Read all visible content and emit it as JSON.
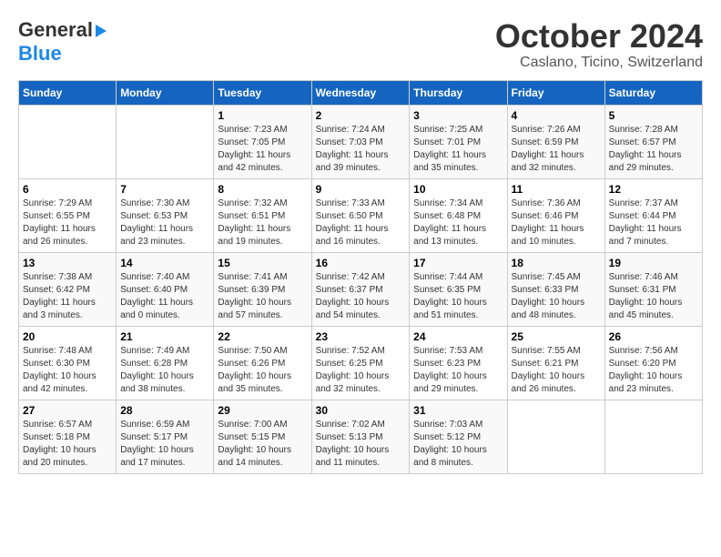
{
  "logo": {
    "line1": "General",
    "line2": "Blue"
  },
  "title": "October 2024",
  "subtitle": "Caslano, Ticino, Switzerland",
  "weekdays": [
    "Sunday",
    "Monday",
    "Tuesday",
    "Wednesday",
    "Thursday",
    "Friday",
    "Saturday"
  ],
  "weeks": [
    [
      {
        "day": "",
        "info": ""
      },
      {
        "day": "",
        "info": ""
      },
      {
        "day": "1",
        "info": "Sunrise: 7:23 AM\nSunset: 7:05 PM\nDaylight: 11 hours and 42 minutes."
      },
      {
        "day": "2",
        "info": "Sunrise: 7:24 AM\nSunset: 7:03 PM\nDaylight: 11 hours and 39 minutes."
      },
      {
        "day": "3",
        "info": "Sunrise: 7:25 AM\nSunset: 7:01 PM\nDaylight: 11 hours and 35 minutes."
      },
      {
        "day": "4",
        "info": "Sunrise: 7:26 AM\nSunset: 6:59 PM\nDaylight: 11 hours and 32 minutes."
      },
      {
        "day": "5",
        "info": "Sunrise: 7:28 AM\nSunset: 6:57 PM\nDaylight: 11 hours and 29 minutes."
      }
    ],
    [
      {
        "day": "6",
        "info": "Sunrise: 7:29 AM\nSunset: 6:55 PM\nDaylight: 11 hours and 26 minutes."
      },
      {
        "day": "7",
        "info": "Sunrise: 7:30 AM\nSunset: 6:53 PM\nDaylight: 11 hours and 23 minutes."
      },
      {
        "day": "8",
        "info": "Sunrise: 7:32 AM\nSunset: 6:51 PM\nDaylight: 11 hours and 19 minutes."
      },
      {
        "day": "9",
        "info": "Sunrise: 7:33 AM\nSunset: 6:50 PM\nDaylight: 11 hours and 16 minutes."
      },
      {
        "day": "10",
        "info": "Sunrise: 7:34 AM\nSunset: 6:48 PM\nDaylight: 11 hours and 13 minutes."
      },
      {
        "day": "11",
        "info": "Sunrise: 7:36 AM\nSunset: 6:46 PM\nDaylight: 11 hours and 10 minutes."
      },
      {
        "day": "12",
        "info": "Sunrise: 7:37 AM\nSunset: 6:44 PM\nDaylight: 11 hours and 7 minutes."
      }
    ],
    [
      {
        "day": "13",
        "info": "Sunrise: 7:38 AM\nSunset: 6:42 PM\nDaylight: 11 hours and 3 minutes."
      },
      {
        "day": "14",
        "info": "Sunrise: 7:40 AM\nSunset: 6:40 PM\nDaylight: 11 hours and 0 minutes."
      },
      {
        "day": "15",
        "info": "Sunrise: 7:41 AM\nSunset: 6:39 PM\nDaylight: 10 hours and 57 minutes."
      },
      {
        "day": "16",
        "info": "Sunrise: 7:42 AM\nSunset: 6:37 PM\nDaylight: 10 hours and 54 minutes."
      },
      {
        "day": "17",
        "info": "Sunrise: 7:44 AM\nSunset: 6:35 PM\nDaylight: 10 hours and 51 minutes."
      },
      {
        "day": "18",
        "info": "Sunrise: 7:45 AM\nSunset: 6:33 PM\nDaylight: 10 hours and 48 minutes."
      },
      {
        "day": "19",
        "info": "Sunrise: 7:46 AM\nSunset: 6:31 PM\nDaylight: 10 hours and 45 minutes."
      }
    ],
    [
      {
        "day": "20",
        "info": "Sunrise: 7:48 AM\nSunset: 6:30 PM\nDaylight: 10 hours and 42 minutes."
      },
      {
        "day": "21",
        "info": "Sunrise: 7:49 AM\nSunset: 6:28 PM\nDaylight: 10 hours and 38 minutes."
      },
      {
        "day": "22",
        "info": "Sunrise: 7:50 AM\nSunset: 6:26 PM\nDaylight: 10 hours and 35 minutes."
      },
      {
        "day": "23",
        "info": "Sunrise: 7:52 AM\nSunset: 6:25 PM\nDaylight: 10 hours and 32 minutes."
      },
      {
        "day": "24",
        "info": "Sunrise: 7:53 AM\nSunset: 6:23 PM\nDaylight: 10 hours and 29 minutes."
      },
      {
        "day": "25",
        "info": "Sunrise: 7:55 AM\nSunset: 6:21 PM\nDaylight: 10 hours and 26 minutes."
      },
      {
        "day": "26",
        "info": "Sunrise: 7:56 AM\nSunset: 6:20 PM\nDaylight: 10 hours and 23 minutes."
      }
    ],
    [
      {
        "day": "27",
        "info": "Sunrise: 6:57 AM\nSunset: 5:18 PM\nDaylight: 10 hours and 20 minutes."
      },
      {
        "day": "28",
        "info": "Sunrise: 6:59 AM\nSunset: 5:17 PM\nDaylight: 10 hours and 17 minutes."
      },
      {
        "day": "29",
        "info": "Sunrise: 7:00 AM\nSunset: 5:15 PM\nDaylight: 10 hours and 14 minutes."
      },
      {
        "day": "30",
        "info": "Sunrise: 7:02 AM\nSunset: 5:13 PM\nDaylight: 10 hours and 11 minutes."
      },
      {
        "day": "31",
        "info": "Sunrise: 7:03 AM\nSunset: 5:12 PM\nDaylight: 10 hours and 8 minutes."
      },
      {
        "day": "",
        "info": ""
      },
      {
        "day": "",
        "info": ""
      }
    ]
  ]
}
